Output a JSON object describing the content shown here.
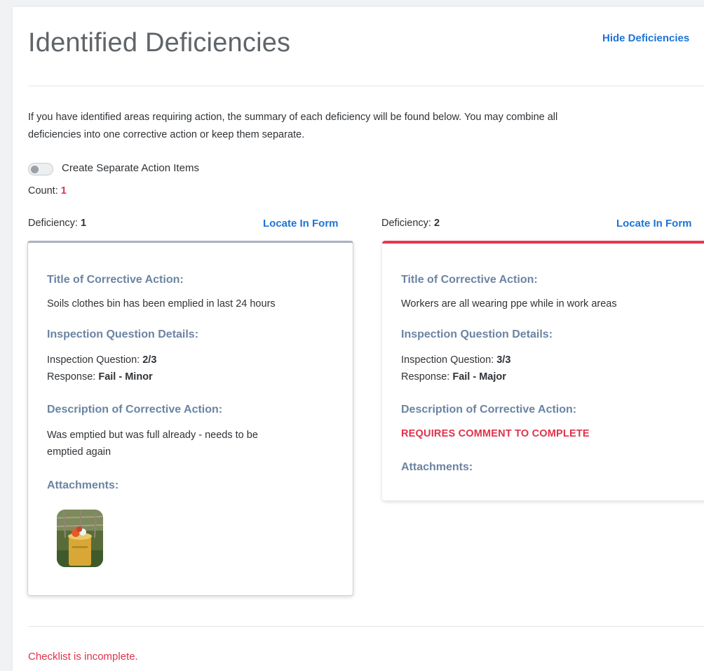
{
  "header": {
    "title": "Identified Deficiencies",
    "hide_link": "Hide Deficiencies"
  },
  "intro": {
    "line1": "If you have identified areas requiring action, the summary of each deficiency will be found below. You may combine all",
    "line2": "deficiencies into one corrective action or keep them separate."
  },
  "toggle": {
    "label": "Create Separate Action Items",
    "state": "off"
  },
  "count": {
    "label": "Count:",
    "value": "1"
  },
  "deficiencies": [
    {
      "label": "Deficiency:",
      "number": "1",
      "locate": "Locate In Form",
      "title_heading": "Title of Corrective Action:",
      "title": "Soils clothes bin has been emplied in last 24 hours",
      "details_heading": "Inspection Question Details:",
      "question_label": "Inspection Question:",
      "question_value": "2/3",
      "response_label": "Response:",
      "response_value": "Fail - Minor",
      "description_heading": "Description of Corrective Action:",
      "description_line1": "Was emptied but was full already - needs to be",
      "description_line2": "emptied again",
      "attachments_heading": "Attachments:",
      "accent": "#aab3bf"
    },
    {
      "label": "Deficiency:",
      "number": "2",
      "locate": "Locate In Form",
      "title_heading": "Title of Corrective Action:",
      "title": "Workers are all wearing ppe while in work areas",
      "details_heading": "Inspection Question Details:",
      "question_label": "Inspection Question:",
      "question_value": "3/3",
      "response_label": "Response:",
      "response_value": "Fail - Major",
      "description_heading": "Description of Corrective Action:",
      "requires_comment": "REQUIRES COMMENT TO COMPLETE",
      "attachments_heading": "Attachments:",
      "accent": "#e8384f"
    }
  ],
  "footer": {
    "status": "Checklist is incomplete."
  },
  "colors": {
    "link": "#1d74d6",
    "alert": "#e0324b",
    "section_heading": "#6b84a3"
  }
}
